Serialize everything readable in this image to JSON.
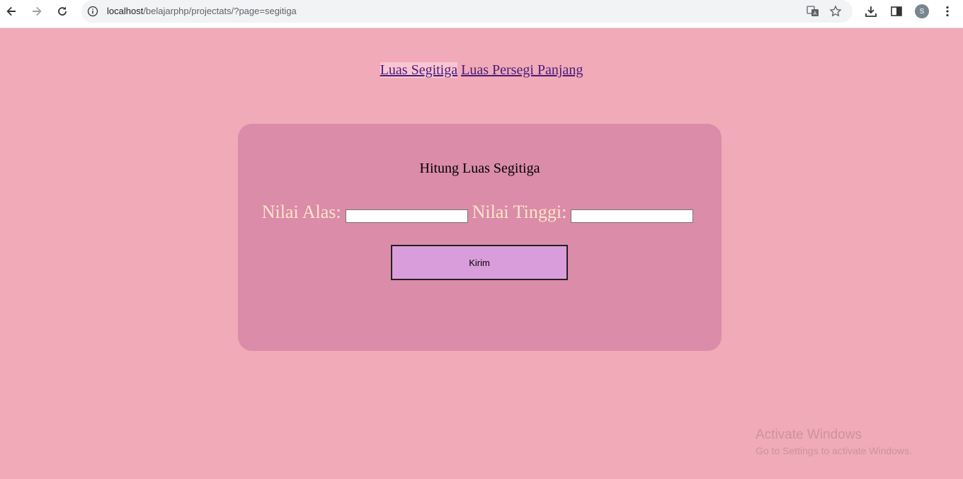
{
  "browser": {
    "url_host": "localhost",
    "url_path": "/belajarphp/projectats/?page=segitiga",
    "avatar_initial": "S",
    "icons": [
      "back-arrow-icon",
      "forward-arrow-icon",
      "reload-icon",
      "info-icon",
      "translate-icon",
      "star-icon",
      "download-icon",
      "side-panel-icon",
      "more-vert-icon"
    ]
  },
  "nav": {
    "links": [
      "Luas Segitiga",
      "Luas Persegi Panjang"
    ]
  },
  "form": {
    "title": "Hitung Luas Segitiga",
    "alas_label": "Nilai Alas:",
    "alas_value": "",
    "tinggi_label": "Nilai Tinggi:",
    "tinggi_value": "",
    "submit_label": "Kirim"
  },
  "watermark": {
    "line1": "Activate Windows",
    "line2": "Go to Settings to activate Windows."
  },
  "colors": {
    "page_bg": "#f0aab8",
    "card_bg": "#db8ca8",
    "button_bg": "#da9ddb",
    "label_color": "#fde5c8",
    "link_color": "#4a1a7a"
  }
}
